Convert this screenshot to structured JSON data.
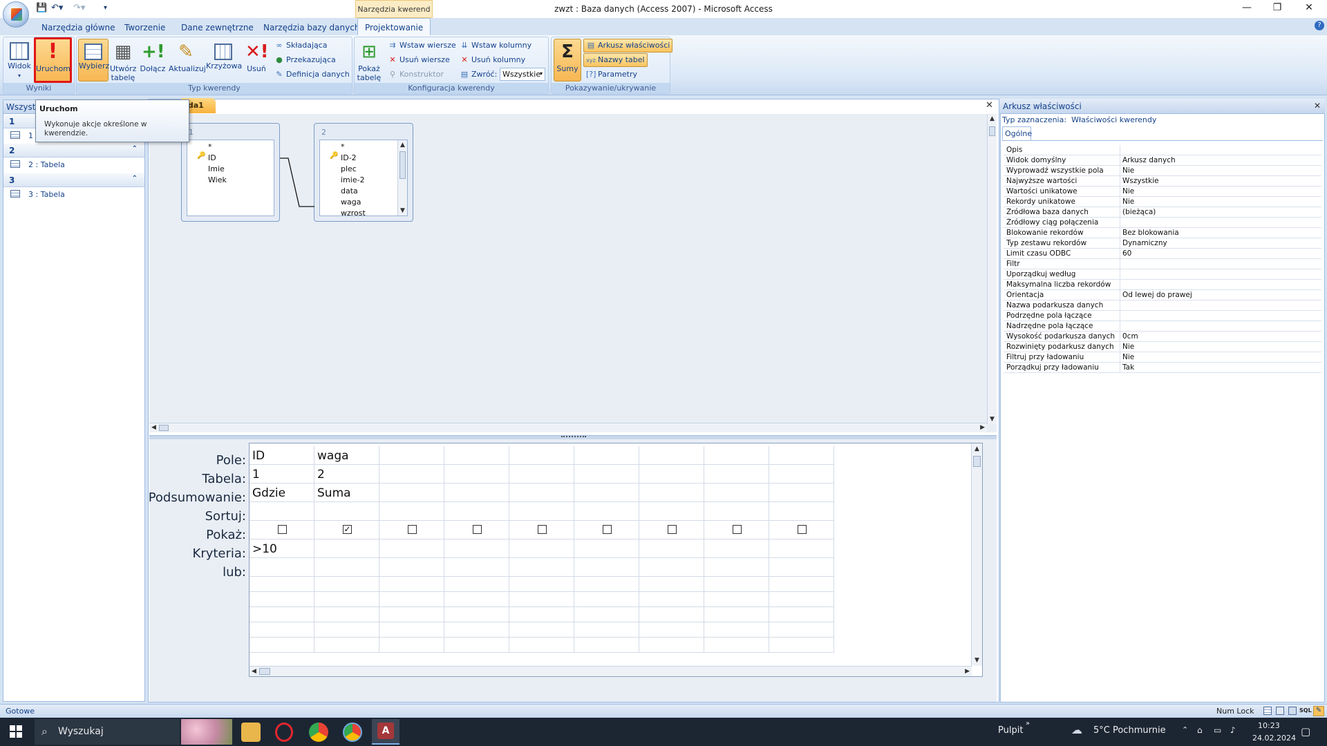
{
  "window": {
    "title": "zwzt : Baza danych (Access 2007) - Microsoft Access",
    "context_tab_label": "Narzędzia kwerend",
    "controls": {
      "minimize": "—",
      "restore": "❐",
      "close": "✕"
    }
  },
  "tabs": [
    "Narzędzia główne",
    "Tworzenie",
    "Dane zewnętrzne",
    "Narzędzia bazy danych",
    "Projektowanie"
  ],
  "active_tab": "Projektowanie",
  "ribbon": {
    "wyniki": {
      "label": "Wyniki",
      "widok": "Widok",
      "uruchom": "Uruchom"
    },
    "typ_kwerendy": {
      "label": "Typ kwerendy",
      "wybierz": "Wybierz",
      "utworz_line1": "Utwórz",
      "utworz_line2": "tabelę",
      "dolacz": "Dołącz",
      "aktualizuj": "Aktualizuj",
      "krzyzowa": "Krzyżowa",
      "usun": "Usuń",
      "skladajaca": "Składająca",
      "przekazujaca": "Przekazująca",
      "definicja": "Definicja danych"
    },
    "konfiguracja": {
      "label": "Konfiguracja kwerendy",
      "pokaz_line1": "Pokaż",
      "pokaz_line2": "tabelę",
      "wstaw_wiersze": "Wstaw wiersze",
      "usun_wiersze": "Usuń wiersze",
      "konstruktor": "Konstruktor",
      "wstaw_kolumny": "Wstaw kolumny",
      "usun_kolumny": "Usuń kolumny",
      "zwroc": "Zwróć:",
      "zwroc_value": "Wszystkie"
    },
    "pokazywanie": {
      "label": "Pokazywanie/ukrywanie",
      "sumy": "Sumy",
      "arkusz": "Arkusz właściwości",
      "nazwy_tabel": "Nazwy tabel",
      "parametry": "Parametry"
    }
  },
  "tooltip": {
    "title": "Uruchom",
    "line1": "Wykonuje akcje określone w",
    "line2": "kwerendzie."
  },
  "nav": {
    "header": "Wszystk",
    "groups": [
      {
        "label": "1",
        "item": "1 : Tabela"
      },
      {
        "label": "2",
        "item": "2 : Tabela"
      },
      {
        "label": "3",
        "item": "3 : Tabela"
      }
    ]
  },
  "doc_tab": "nda1",
  "tables": [
    {
      "title": "1",
      "fields": [
        "*",
        "ID",
        "Imie",
        "Wiek"
      ]
    },
    {
      "title": "2",
      "fields": [
        "*",
        "ID-2",
        "plec",
        "imie-2",
        "data",
        "waga",
        "wzrost"
      ]
    }
  ],
  "grid": {
    "row_labels": [
      "Pole:",
      "Tabela:",
      "Podsumowanie:",
      "Sortuj:",
      "Pokaż:",
      "Kryteria:",
      "lub:"
    ],
    "columns": [
      {
        "pole": "ID",
        "tabela": "1",
        "podsumowanie": "Gdzie",
        "sortuj": "",
        "pokaz": false,
        "kryteria": ">10"
      },
      {
        "pole": "waga",
        "tabela": "2",
        "podsumowanie": "Suma",
        "sortuj": "",
        "pokaz": true,
        "kryteria": ""
      }
    ],
    "empty_columns": 7
  },
  "properties": {
    "title": "Arkusz właściwości",
    "selection_type_label": "Typ zaznaczenia:",
    "selection_type_value": "Właściwości kwerendy",
    "tab": "Ogólne",
    "rows": [
      [
        "Opis",
        ""
      ],
      [
        "Widok domyślny",
        "Arkusz danych"
      ],
      [
        "Wyprowadź wszystkie pola",
        "Nie"
      ],
      [
        "Najwyższe wartości",
        "Wszystkie"
      ],
      [
        "Wartości unikatowe",
        "Nie"
      ],
      [
        "Rekordy unikatowe",
        "Nie"
      ],
      [
        "Źródłowa baza danych",
        "(bieżąca)"
      ],
      [
        "Źródłowy ciąg połączenia",
        ""
      ],
      [
        "Blokowanie rekordów",
        "Bez blokowania"
      ],
      [
        "Typ zestawu rekordów",
        "Dynamiczny"
      ],
      [
        "Limit czasu ODBC",
        "60"
      ],
      [
        "Filtr",
        ""
      ],
      [
        "Uporządkuj według",
        ""
      ],
      [
        "Maksymalna liczba rekordów",
        ""
      ],
      [
        "Orientacja",
        "Od lewej do prawej"
      ],
      [
        "Nazwa podarkusza danych",
        ""
      ],
      [
        "Podrzędne pola łączące",
        ""
      ],
      [
        "Nadrzędne pola łączące",
        ""
      ],
      [
        "Wysokość podarkusza danych",
        "0cm"
      ],
      [
        "Rozwinięty podarkusz danych",
        "Nie"
      ],
      [
        "Filtruj przy ładowaniu",
        "Nie"
      ],
      [
        "Porządkuj przy ładowaniu",
        "Tak"
      ]
    ]
  },
  "status": {
    "left": "Gotowe",
    "numlock": "Num Lock",
    "sql": "SQL"
  },
  "taskbar": {
    "search_placeholder": "Wyszukaj",
    "pulpit": "Pulpit",
    "weather": "5°C  Pochmurnie",
    "time": "10:23",
    "date": "24.02.2024"
  }
}
